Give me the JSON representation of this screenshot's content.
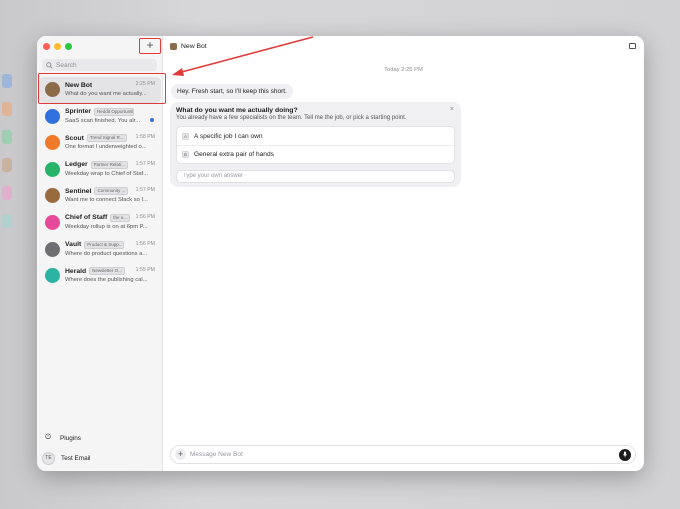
{
  "window": {
    "traffic_colors": [
      "#ff5f57",
      "#febc2e",
      "#28c840"
    ]
  },
  "sidebar": {
    "new_button": "+",
    "search_placeholder": "Search",
    "conversations": [
      {
        "name": "New Bot",
        "tag": "",
        "time": "2:25 PM",
        "preview": "What do you want me actually...",
        "avatar_color": "#8b6b4a",
        "avatar_icon": "bot-icon",
        "active": true,
        "unread": false
      },
      {
        "name": "Sprinter",
        "tag": "Reddit Opportuniti...",
        "time": "",
        "preview": "SaaS scan finished. You alr...",
        "avatar_color": "#2f6fde",
        "avatar_icon": "bot-icon",
        "active": false,
        "unread": true
      },
      {
        "name": "Scout",
        "tag": "Trend Signal R...",
        "time": "1:58 PM",
        "preview": "One format I underweighted o...",
        "avatar_color": "#f07a2a",
        "avatar_icon": "bot-icon",
        "active": false,
        "unread": false
      },
      {
        "name": "Ledger",
        "tag": "Partner Relati...",
        "time": "1:57 PM",
        "preview": "Weekday wrap to Chief of Staf...",
        "avatar_color": "#27b36a",
        "avatar_icon": "bot-icon",
        "active": false,
        "unread": false
      },
      {
        "name": "Sentinel",
        "tag": "Community ...",
        "time": "1:57 PM",
        "preview": "Want me to connect Slack so I...",
        "avatar_color": "#9a6a3f",
        "avatar_icon": "bot-icon",
        "active": false,
        "unread": false
      },
      {
        "name": "Chief of Staff",
        "tag": "the o...",
        "time": "1:56 PM",
        "preview": "Weekday rollup is on at 6pm P...",
        "avatar_color": "#e84a9a",
        "avatar_icon": "bot-icon",
        "active": false,
        "unread": false
      },
      {
        "name": "Vault",
        "tag": "Product & Supp...",
        "time": "1:56 PM",
        "preview": "Where do product questions a...",
        "avatar_color": "#6f6f73",
        "avatar_icon": "bot-icon",
        "active": false,
        "unread": false
      },
      {
        "name": "Herald",
        "tag": "Newsletter O...",
        "time": "1:55 PM",
        "preview": "Where does the publishing cal...",
        "avatar_color": "#2bb3a3",
        "avatar_icon": "bot-icon",
        "active": false,
        "unread": false
      }
    ],
    "footer": {
      "plugins_label": "Plugins",
      "user_initials": "TE",
      "user_name": "Test Email"
    }
  },
  "main": {
    "title": "New Bot",
    "date_label": "Today 2:25 PM",
    "bot_message": "Hey. Fresh start, so I'll keep this short.",
    "question": {
      "title": "What do you want me actually doing?",
      "subtitle": "You already have a few specialists on the team. Tell me the job, or pick a starting point.",
      "close": "×",
      "options": [
        {
          "key": "A",
          "label": "A specific job I can own"
        },
        {
          "key": "B",
          "label": "General extra pair of hands"
        }
      ],
      "answer_placeholder": "Type your own answer"
    },
    "composer": {
      "placeholder": "Message New Bot",
      "plus": "+"
    }
  },
  "annotation": {
    "color": "#e03b3b"
  }
}
